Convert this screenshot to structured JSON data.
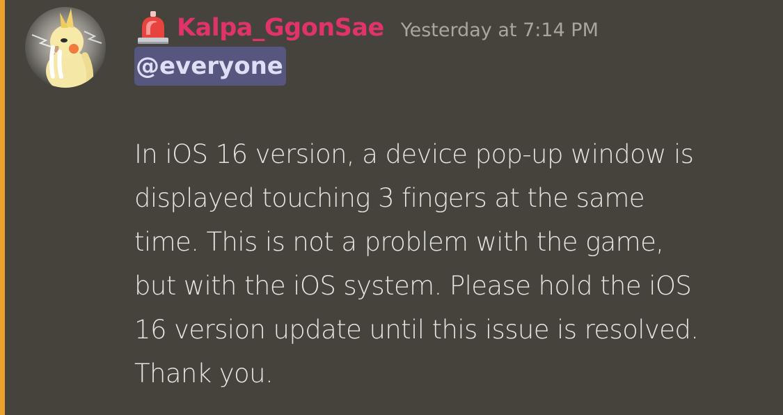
{
  "message": {
    "author": {
      "name": "Kalpa_GgonSae",
      "name_color": "#e0336a",
      "role_icon": "siren-icon",
      "avatar": "cockatiel-avatar"
    },
    "timestamp": "Yesterday at 7:14 PM",
    "mention": "@everyone",
    "body_lines": [
      "In iOS 16 version, a device pop-up window is",
      "displayed touching 3 fingers at the same",
      "time. This is not a problem with the game,",
      "but with the iOS system. Please hold the iOS",
      "16 version update until this issue is resolved.",
      "Thank you."
    ]
  },
  "colors": {
    "background": "#46433d",
    "mention_highlight_bar": "#e9a32c",
    "mention_pill": "#56567e",
    "text": "#e6e4df",
    "timestamp": "#aaa69e"
  }
}
